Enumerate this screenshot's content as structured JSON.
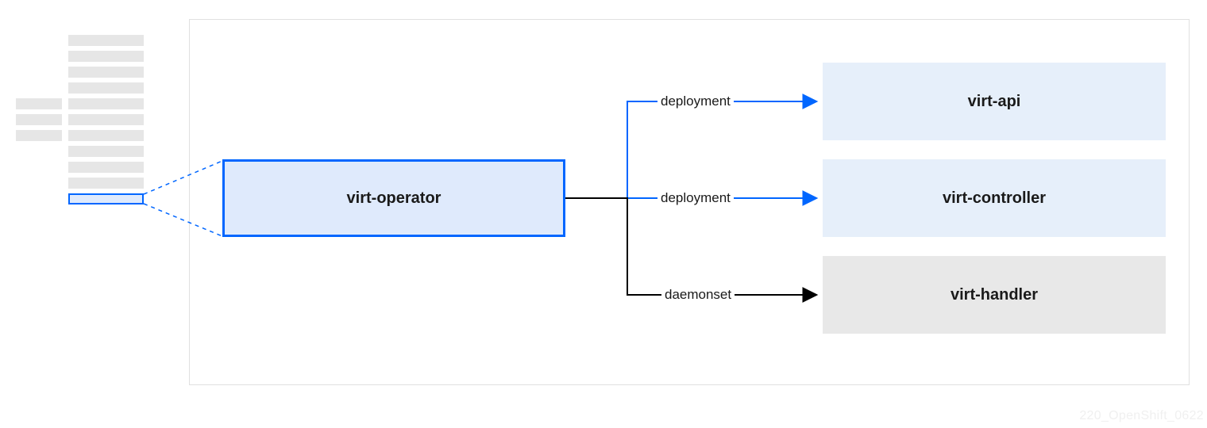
{
  "nodes": {
    "operator": "virt-operator",
    "api": "virt-api",
    "controller": "virt-controller",
    "handler": "virt-handler"
  },
  "edges": {
    "to_api": "deployment",
    "to_controller": "deployment",
    "to_handler": "daemonset"
  },
  "footer": "220_OpenShift_0622",
  "colors": {
    "primary_blue": "#0066ff",
    "light_blue": "#dfeafc",
    "softer_blue": "#e6effa",
    "grey_fill": "#e8e8e8",
    "stack_grey": "#e6e6e6",
    "black": "#000000"
  }
}
